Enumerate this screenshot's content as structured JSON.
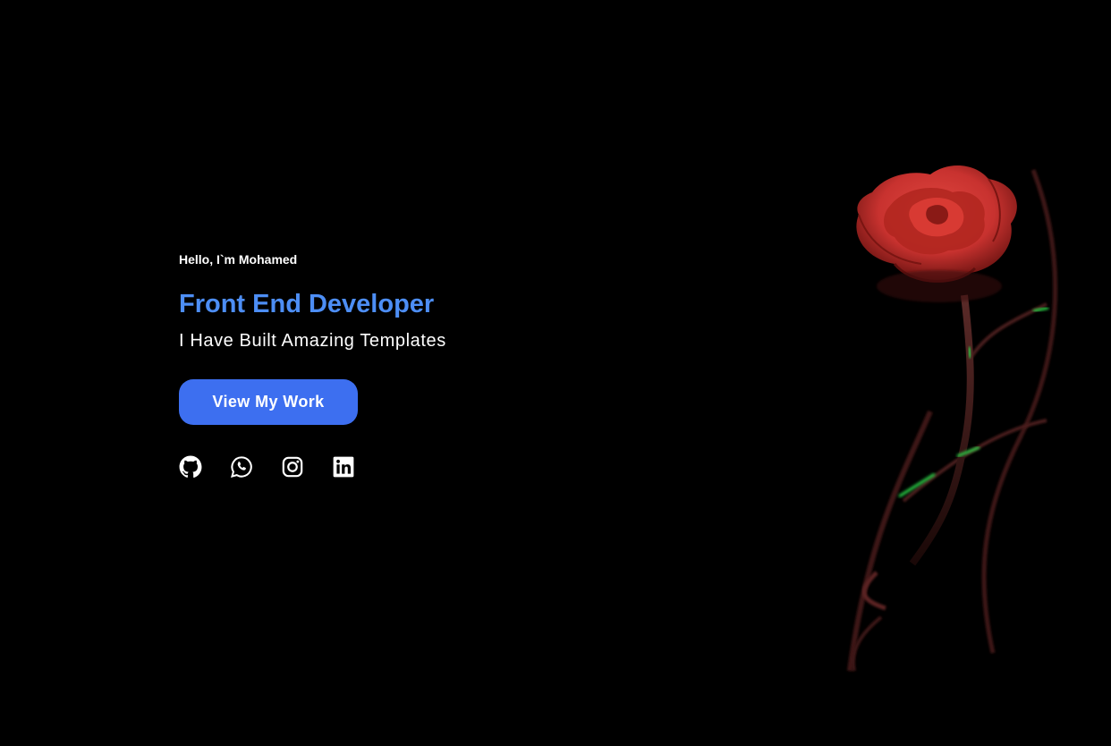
{
  "hero": {
    "greeting": "Hello, I`m Mohamed",
    "role": "Front End Developer",
    "tagline": "I Have Built Amazing Templates",
    "cta_label": "View My Work"
  },
  "socials": [
    {
      "icon": "github-icon"
    },
    {
      "icon": "whatsapp-icon"
    },
    {
      "icon": "instagram-icon"
    },
    {
      "icon": "linkedin-icon"
    }
  ],
  "colors": {
    "background": "#000000",
    "accent_text": "#4d8ef5",
    "button": "#3d6ff0",
    "text": "#ffffff",
    "rose": "#c8322f",
    "glow": "#2bd94a"
  },
  "illustration": "red-rose-image"
}
